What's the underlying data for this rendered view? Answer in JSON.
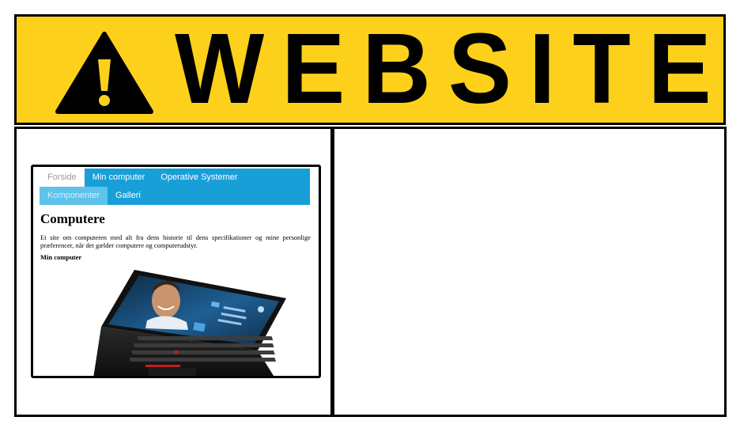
{
  "banner": {
    "title": "WEBSITE",
    "icon": "warning-triangle-icon",
    "background_color": "#fdd11b"
  },
  "preview": {
    "nav": {
      "row1": [
        "Forside",
        "Min computer",
        "Operative Systemer"
      ],
      "row2": [
        "Komponenter",
        "Galleri"
      ],
      "accent_color": "#199fd8"
    },
    "heading": "Computere",
    "description": "Et site om computeren med alt fra dens historie til dens specifikationer og mine personlige præferencer, når det gælder computere og computerudstyr.",
    "subheading": "Min computer",
    "image": "laptop-image"
  }
}
